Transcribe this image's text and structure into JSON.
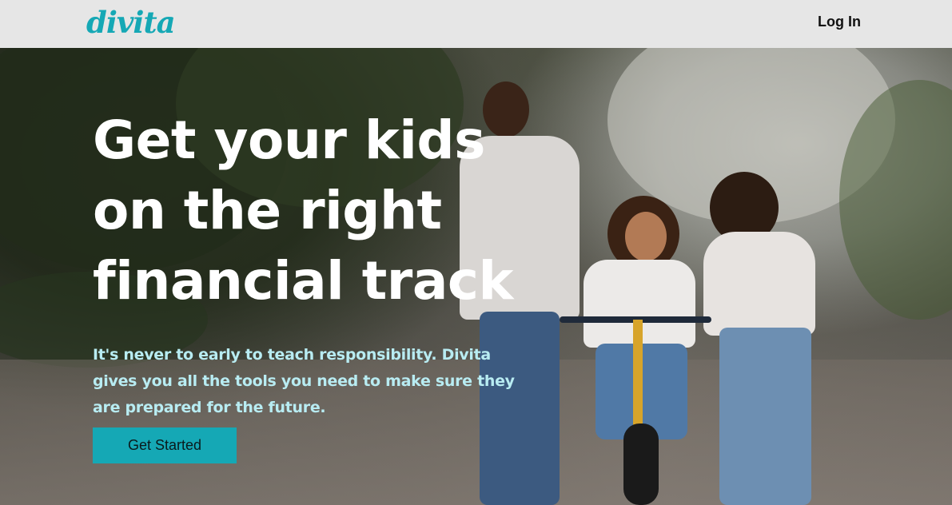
{
  "header": {
    "logo_text": "divita",
    "login_label": "Log In"
  },
  "hero": {
    "headline_lines": [
      "Get your kids",
      "on the right",
      "financial track"
    ],
    "subtext": "It's never to early to teach responsibility. Divita gives you all the tools you need to make sure they are prepared for the future.",
    "cta_label": "Get Started"
  },
  "colors": {
    "accent": "#15a8b5",
    "header_bg": "#e6e6e6",
    "subtext": "#b8ecf2"
  }
}
